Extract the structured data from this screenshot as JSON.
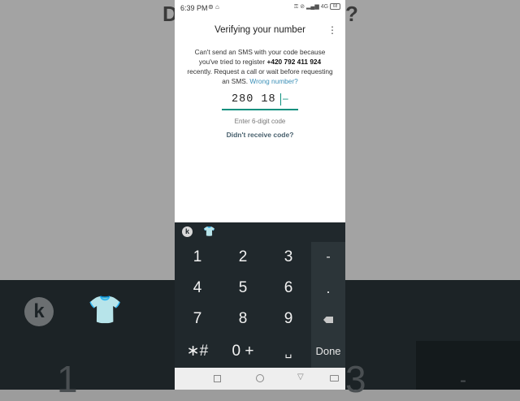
{
  "status_bar": {
    "time": "6:39 PM",
    "network": "4G",
    "battery": "68"
  },
  "header": {
    "title": "Verifying your number",
    "menu_icon": "more-vert-icon"
  },
  "message": {
    "part1": "Can't send an SMS with your code because you've tried to register ",
    "phone": "+420 792 411 924",
    "part2": " recently. Request a call or wait before requesting an SMS. ",
    "link": "Wrong number?"
  },
  "code_input": {
    "value": "280 18",
    "placeholder": "–"
  },
  "hint": "Enter 6-digit code",
  "resend_link": "Didn't receive code?",
  "keyboard": {
    "keys": [
      "1",
      "2",
      "3",
      "4",
      "5",
      "6",
      "7",
      "8",
      "9",
      "∗#",
      "0 +",
      "␣"
    ],
    "right_keys": [
      "-",
      ".",
      "",
      "Done"
    ],
    "toolbar_icons": [
      "kika-logo-icon",
      "shirt-icon"
    ]
  },
  "background": {
    "title_left": "D",
    "title_right": "?",
    "key_left": "1",
    "key_right": "3",
    "dash": "-"
  },
  "colors": {
    "accent": "#0b8f7e",
    "link": "#3a8fb7",
    "keyboard_bg": "#20282c"
  }
}
